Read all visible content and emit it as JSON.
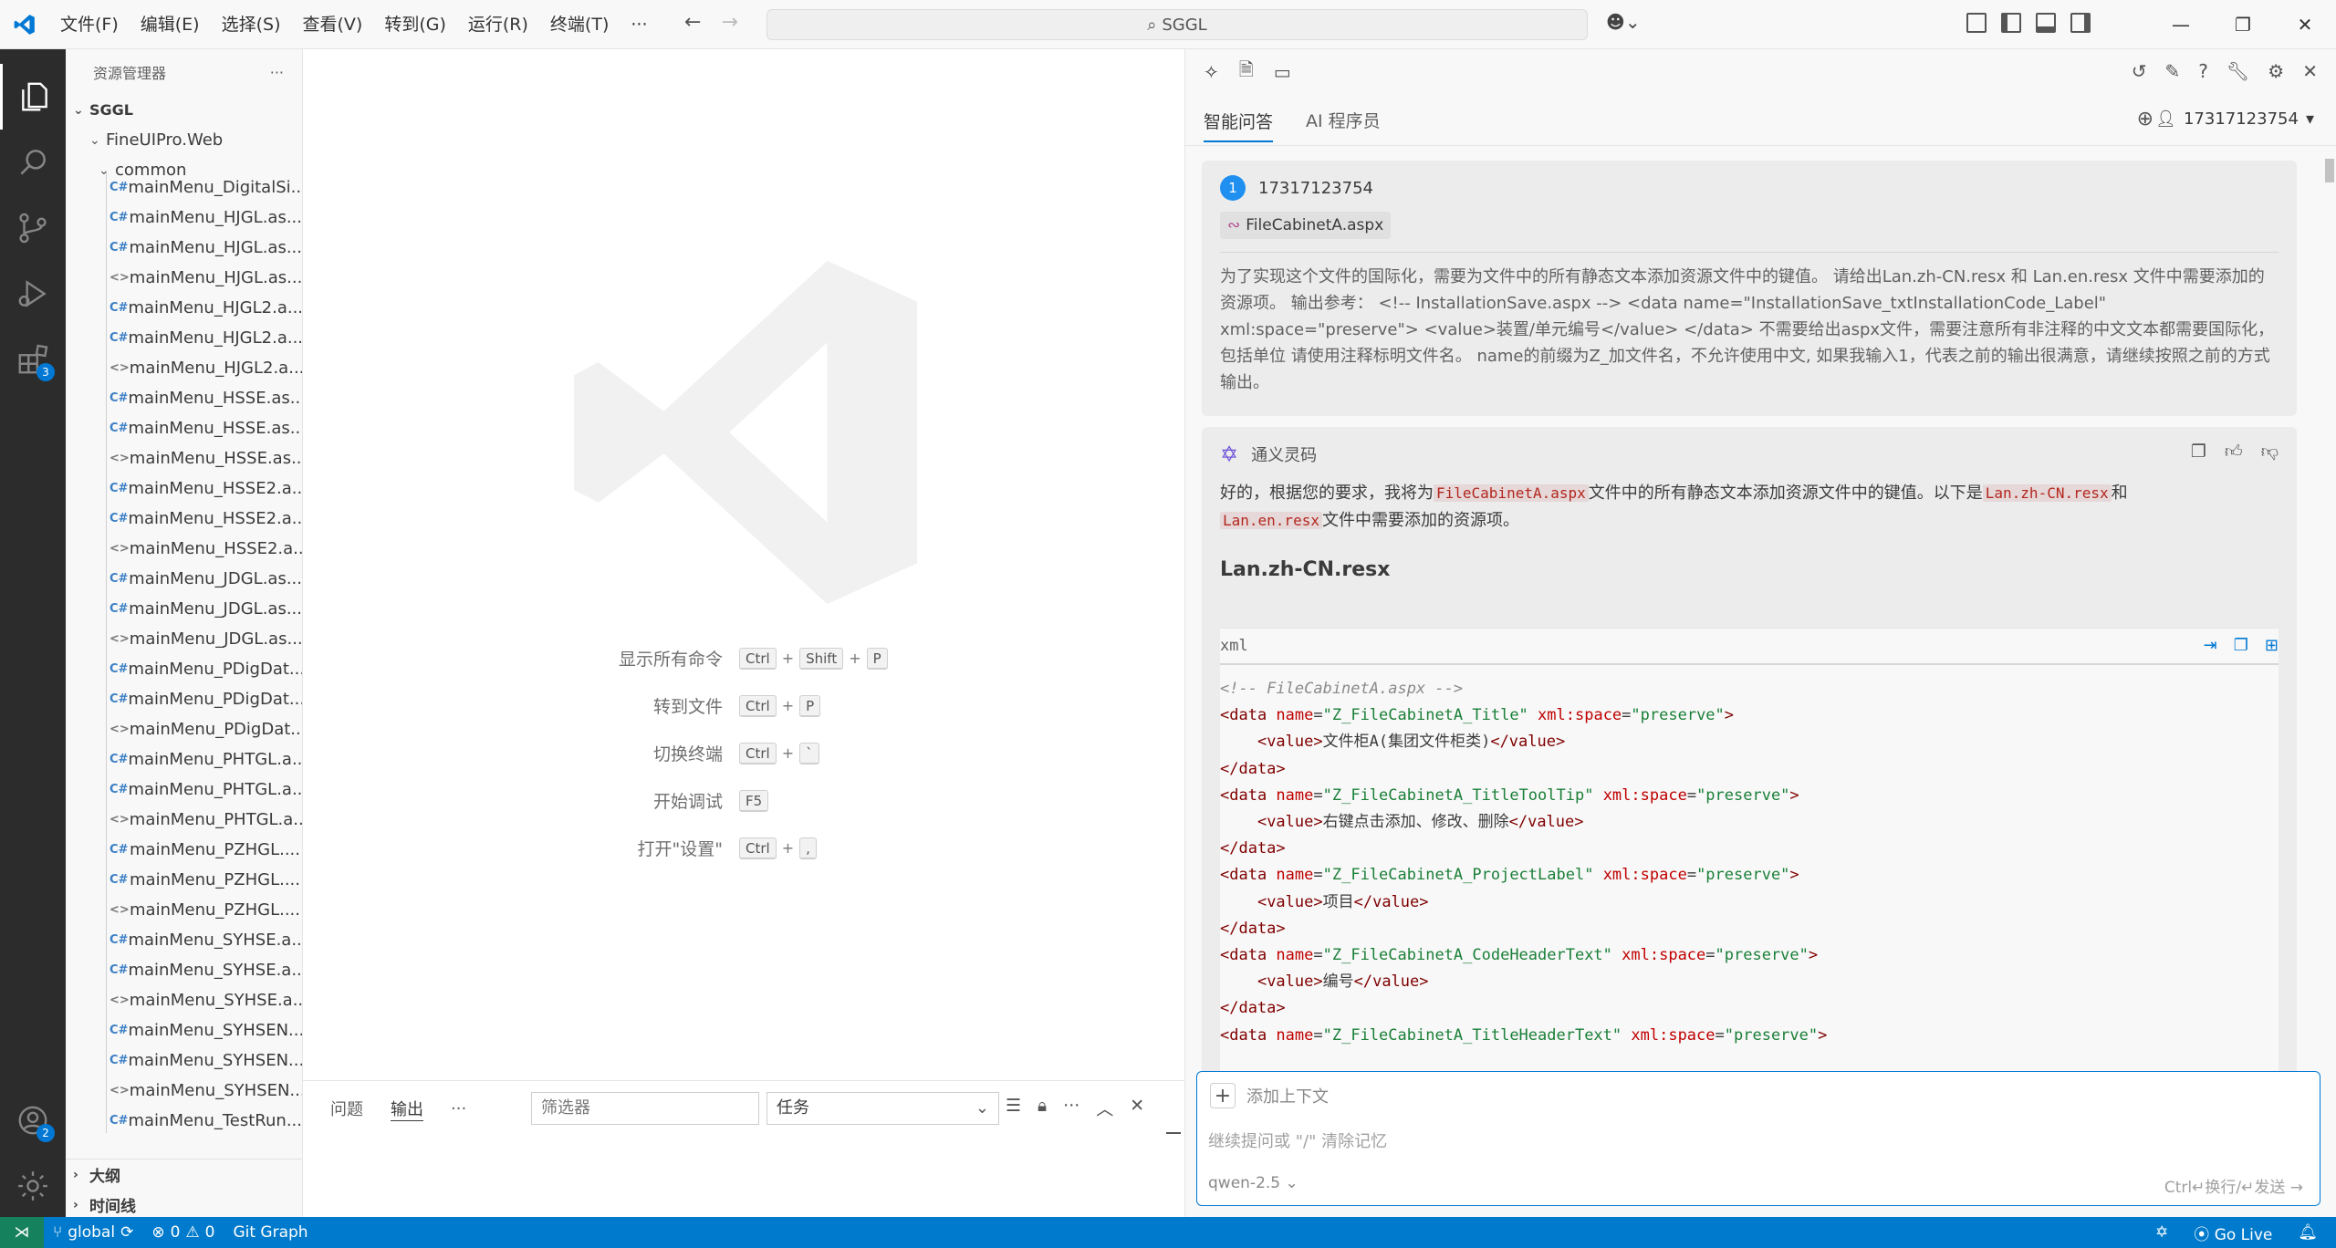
{
  "titlebar": {
    "menu": [
      "文件(F)",
      "编辑(E)",
      "选择(S)",
      "查看(V)",
      "转到(G)",
      "运行(R)",
      "终端(T)",
      "···"
    ],
    "search_text": "SGGL",
    "window_controls": [
      "—",
      "❐",
      "✕"
    ]
  },
  "activitybar": {
    "extensions_badge": "3",
    "accounts_badge": "2"
  },
  "explorer": {
    "title": "资源管理器",
    "more": "···",
    "root": "SGGL",
    "project": "FineUIPro.Web",
    "folder": "common",
    "files": [
      {
        "name": "mainMenu_DigitalSi...",
        "type": "cs"
      },
      {
        "name": "mainMenu_HJGL.as...",
        "type": "cs"
      },
      {
        "name": "mainMenu_HJGL.as...",
        "type": "cs"
      },
      {
        "name": "mainMenu_HJGL.as...",
        "type": "code"
      },
      {
        "name": "mainMenu_HJGL2.a...",
        "type": "cs"
      },
      {
        "name": "mainMenu_HJGL2.a...",
        "type": "cs"
      },
      {
        "name": "mainMenu_HJGL2.a...",
        "type": "code"
      },
      {
        "name": "mainMenu_HSSE.as...",
        "type": "cs"
      },
      {
        "name": "mainMenu_HSSE.as...",
        "type": "cs"
      },
      {
        "name": "mainMenu_HSSE.as...",
        "type": "code"
      },
      {
        "name": "mainMenu_HSSE2.a...",
        "type": "cs"
      },
      {
        "name": "mainMenu_HSSE2.a...",
        "type": "cs"
      },
      {
        "name": "mainMenu_HSSE2.a...",
        "type": "code"
      },
      {
        "name": "mainMenu_JDGL.as...",
        "type": "cs"
      },
      {
        "name": "mainMenu_JDGL.as...",
        "type": "cs"
      },
      {
        "name": "mainMenu_JDGL.as...",
        "type": "code"
      },
      {
        "name": "mainMenu_PDigDat...",
        "type": "cs"
      },
      {
        "name": "mainMenu_PDigDat...",
        "type": "cs"
      },
      {
        "name": "mainMenu_PDigDat...",
        "type": "code"
      },
      {
        "name": "mainMenu_PHTGL.a...",
        "type": "cs"
      },
      {
        "name": "mainMenu_PHTGL.a...",
        "type": "cs"
      },
      {
        "name": "mainMenu_PHTGL.a...",
        "type": "code"
      },
      {
        "name": "mainMenu_PZHGL....",
        "type": "cs"
      },
      {
        "name": "mainMenu_PZHGL....",
        "type": "cs"
      },
      {
        "name": "mainMenu_PZHGL....",
        "type": "code"
      },
      {
        "name": "mainMenu_SYHSE.a...",
        "type": "cs"
      },
      {
        "name": "mainMenu_SYHSE.a...",
        "type": "cs"
      },
      {
        "name": "mainMenu_SYHSE.a...",
        "type": "code"
      },
      {
        "name": "mainMenu_SYHSEN...",
        "type": "cs"
      },
      {
        "name": "mainMenu_SYHSEN...",
        "type": "cs"
      },
      {
        "name": "mainMenu_SYHSEN...",
        "type": "code"
      },
      {
        "name": "mainMenu_TestRun...",
        "type": "cs"
      }
    ],
    "outline": "大纲",
    "timeline": "时间线"
  },
  "editor": {
    "shortcuts": [
      {
        "label": "显示所有命令",
        "keys": [
          "Ctrl",
          "Shift",
          "P"
        ]
      },
      {
        "label": "转到文件",
        "keys": [
          "Ctrl",
          "P"
        ]
      },
      {
        "label": "切换终端",
        "keys": [
          "Ctrl",
          "`"
        ]
      },
      {
        "label": "开始调试",
        "keys": [
          "F5"
        ]
      },
      {
        "label": "打开\"设置\"",
        "keys": [
          "Ctrl",
          ","
        ]
      }
    ]
  },
  "panel": {
    "tabs": [
      "问题",
      "输出",
      "···"
    ],
    "filter_placeholder": "筛选器",
    "select_value": "任务"
  },
  "chat": {
    "tabs": [
      "智能问答",
      "AI 程序员"
    ],
    "user": "17317123754",
    "question": {
      "avatar": "1",
      "user": "17317123754",
      "file": "FileCabinetA.aspx",
      "text": "为了实现这个文件的国际化，需要为文件中的所有静态文本添加资源文件中的键值。 请给出Lan.zh-CN.resx 和 Lan.en.resx 文件中需要添加的资源项。 输出参考： <!-- InstallationSave.aspx --> <data name=\"InstallationSave_txtInstallationCode_Label\" xml:space=\"preserve\"> <value>装置/单元编号</value> </data> 不需要给出aspx文件，需要注意所有非注释的中文文本都需要国际化，包括单位 请使用注释标明文件名。 name的前缀为Z_加文件名，不允许使用中文, 如果我输入1，代表之前的输出很满意，请继续按照之前的方式输出。"
    },
    "answer": {
      "bot": "通义灵码",
      "intro_1": "好的，根据您的要求，我将为",
      "intro_code_1": "FileCabinetA.aspx",
      "intro_2": "文件中的所有静态文本添加资源文件中的键值。以下是",
      "intro_code_2": "Lan.zh-CN.resx",
      "intro_3": "和",
      "intro_code_3": "Lan.en.resx",
      "intro_4": "文件中需要添加的资源项。",
      "heading": "Lan.zh-CN.resx",
      "code_lang": "xml",
      "comment": "<!-- FileCabinetA.aspx -->",
      "entries": [
        {
          "name": "\"Z_FileCabinetA_Title\"",
          "value": "文件柜A(集团文件柜类)"
        },
        {
          "name": "\"Z_FileCabinetA_TitleToolTip\"",
          "value": "右键点击添加、修改、删除"
        },
        {
          "name": "\"Z_FileCabinetA_ProjectLabel\"",
          "value": "项目"
        },
        {
          "name": "\"Z_FileCabinetA_CodeHeaderText\"",
          "value": "编号"
        },
        {
          "name": "\"Z_FileCabinetA_TitleHeaderText\"",
          "value": ""
        }
      ],
      "xml_space": "\"preserve\""
    },
    "input": {
      "context_label": "添加上下文",
      "placeholder": "继续提问或 \"/\" 清除记忆",
      "model": "qwen-2.5 ⌄",
      "send_hint": "Ctrl↵换行/↵发送 →"
    }
  },
  "statusbar": {
    "branch": "global",
    "errors": "0",
    "warnings": "0",
    "git_graph": "Git Graph",
    "go_live": "Go Live"
  }
}
